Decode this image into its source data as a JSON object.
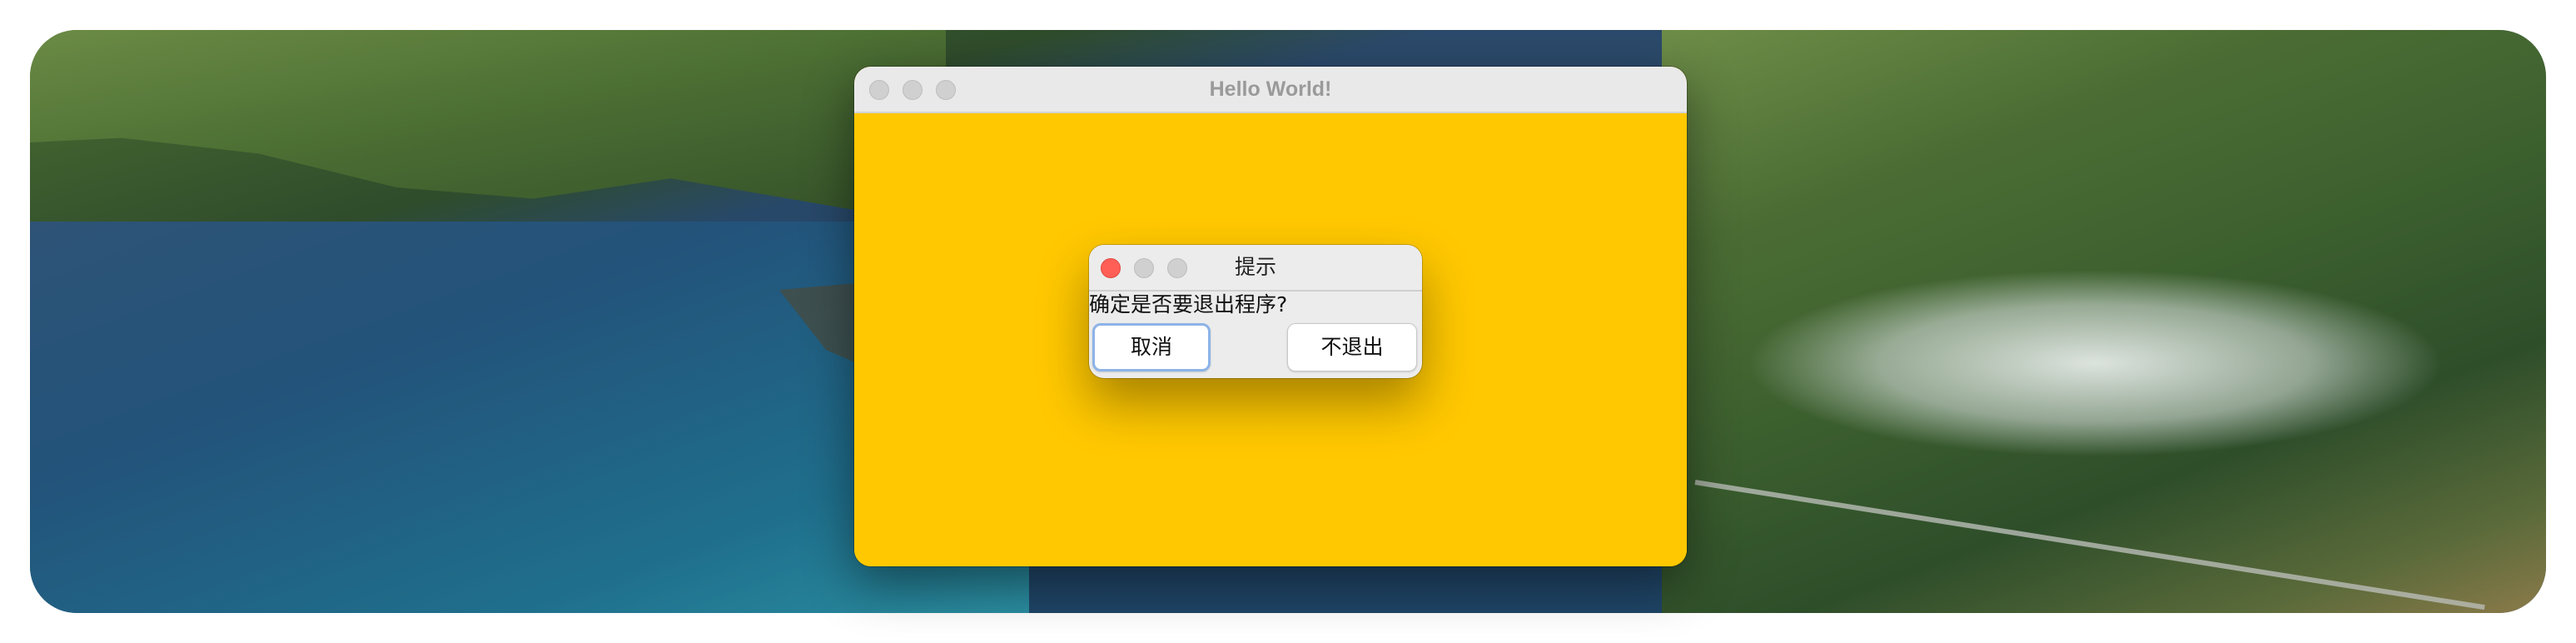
{
  "main_window": {
    "title": "Hello World!",
    "background_color": "#ffc800"
  },
  "dialog": {
    "title": "提示",
    "message": "确定是否要退出程序?",
    "buttons": {
      "cancel": "取消",
      "no_quit": "不退出"
    }
  },
  "colors": {
    "close_button": "#ff5f57",
    "inactive_button": "#d0d0d0",
    "focus_ring": "#8db3e8"
  }
}
